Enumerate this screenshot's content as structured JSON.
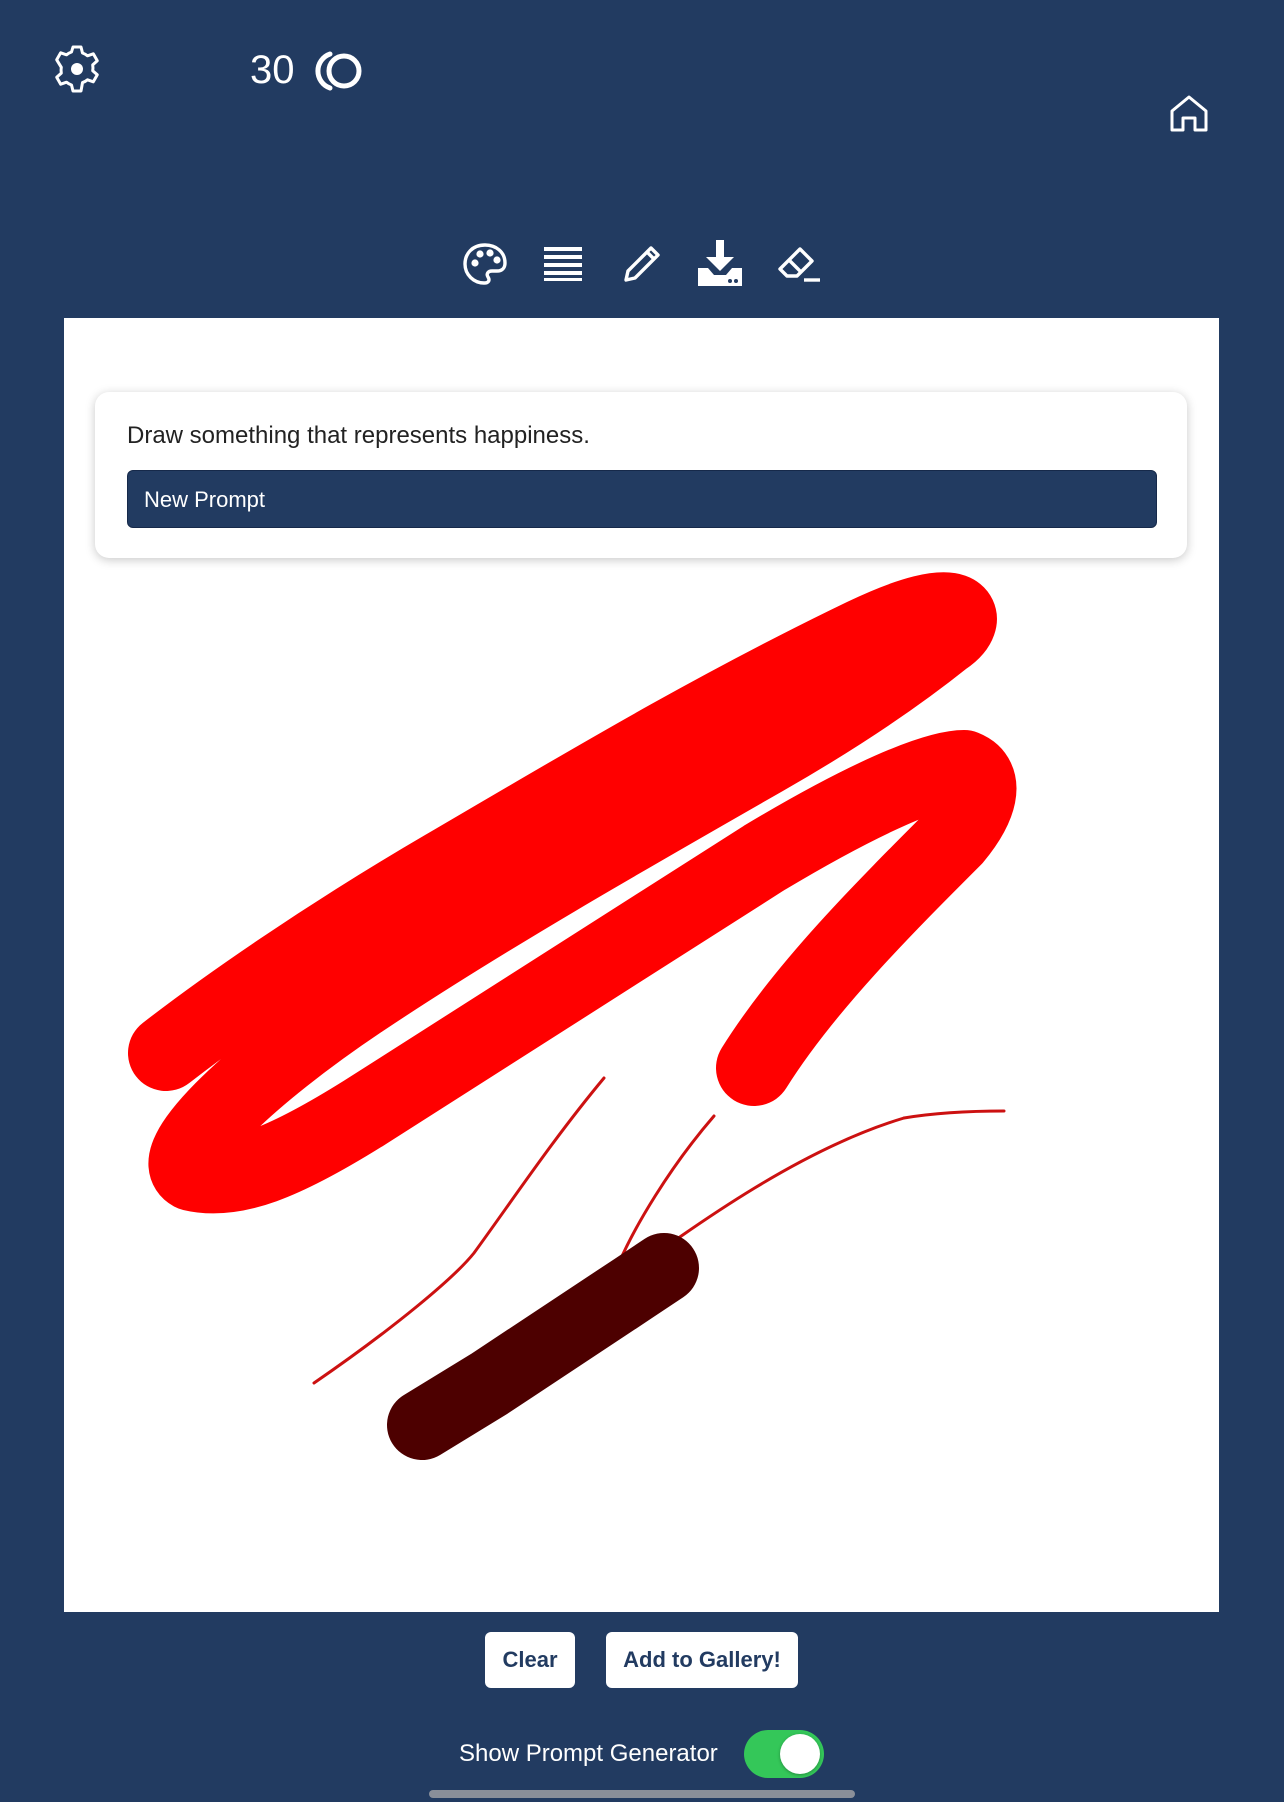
{
  "header": {
    "timer_value": "30",
    "icons": {
      "settings": "gear-icon",
      "timer": "timer-ring-icon",
      "home": "home-icon"
    }
  },
  "toolbar": {
    "tools": [
      "palette-icon",
      "line-width-icon",
      "pencil-icon",
      "download-icon",
      "eraser-icon"
    ]
  },
  "prompt_card": {
    "text": "Draw something that represents happiness.",
    "button_label": "New Prompt"
  },
  "drawing": {
    "stroke_colors": [
      "#ff0000",
      "#4d0000",
      "#cc1111"
    ]
  },
  "actions": {
    "clear_label": "Clear",
    "add_label": "Add to Gallery!"
  },
  "prompt_generator": {
    "label": "Show Prompt Generator",
    "enabled": true
  },
  "colors": {
    "background": "#223b61",
    "canvas": "#ffffff",
    "toggle_on": "#34c759"
  }
}
